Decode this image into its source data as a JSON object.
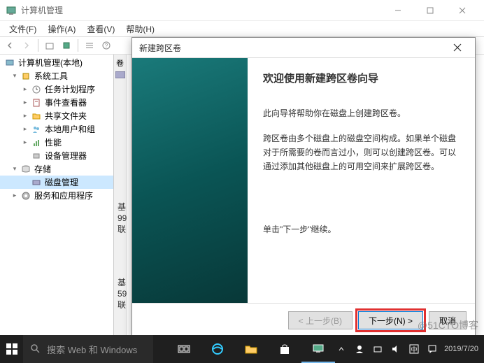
{
  "window": {
    "title": "计算机管理",
    "controls": {
      "min": "minimize",
      "max": "maximize",
      "close": "close"
    }
  },
  "menu": {
    "file": "文件(F)",
    "action": "操作(A)",
    "view": "查看(V)",
    "help": "帮助(H)"
  },
  "tree": {
    "root": "计算机管理(本地)",
    "systools": "系统工具",
    "scheduler": "任务计划程序",
    "eventviewer": "事件查看器",
    "shared": "共享文件夹",
    "localusers": "本地用户和组",
    "perf": "性能",
    "devmgr": "设备管理器",
    "storage": "存储",
    "diskmgmt": "磁盘管理",
    "services": "服务和应用程序"
  },
  "content": {
    "vol_col": "卷",
    "part_prefix": "基",
    "part_size1": "99",
    "part_status1": "联",
    "part_size2": "59",
    "part_status2": "联"
  },
  "dialog": {
    "title": "新建跨区卷",
    "heading": "欢迎使用新建跨区卷向导",
    "p1": "此向导将帮助你在磁盘上创建跨区卷。",
    "p2": "跨区卷由多个磁盘上的磁盘空间构成。如果单个磁盘对于所需要的卷而言过小，则可以创建跨区卷。可以通过添加其他磁盘上的可用空间来扩展跨区卷。",
    "p3": "单击\"下一步\"继续。",
    "back": "< 上一步(B)",
    "next": "下一步(N) >",
    "cancel": "取消"
  },
  "taskbar": {
    "search_placeholder": "搜索 Web 和 Windows"
  },
  "watermark": "@51CTO博客",
  "date_watermark": "2019/7/20"
}
